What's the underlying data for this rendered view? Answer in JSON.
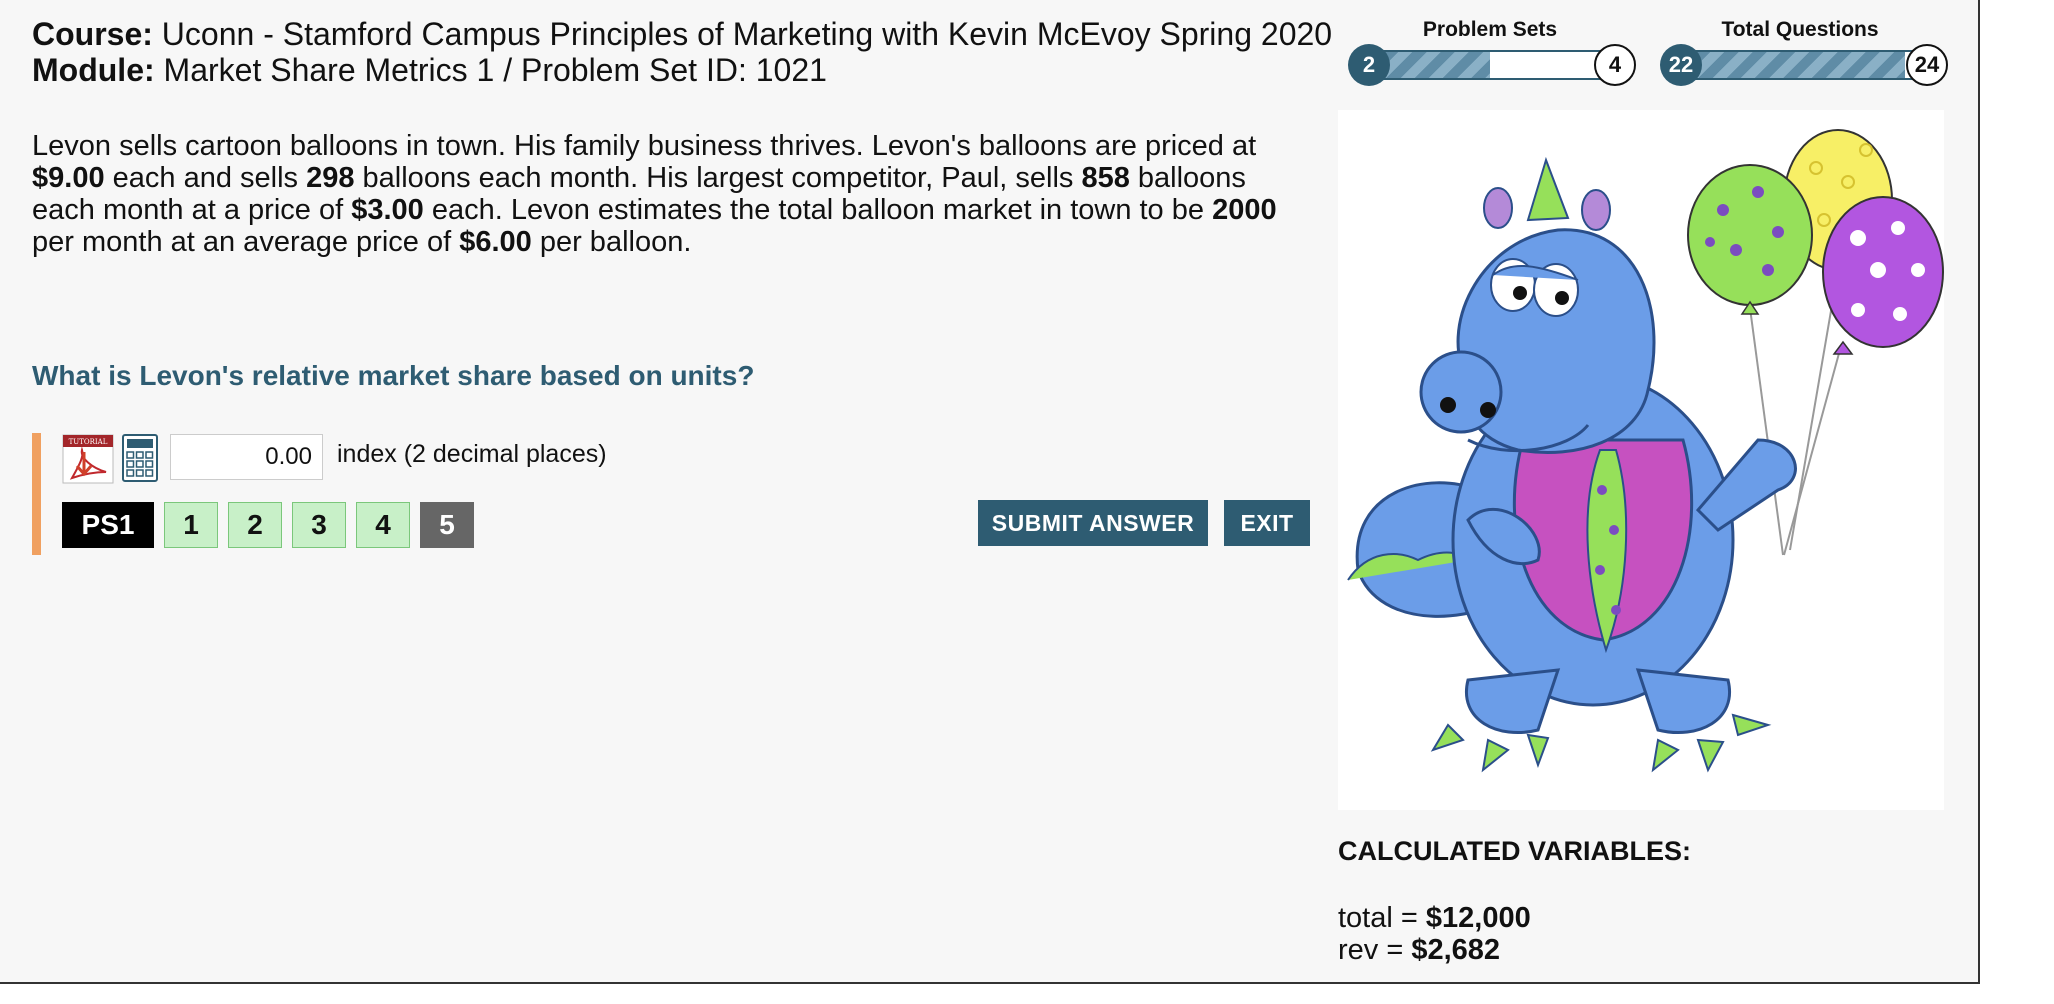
{
  "header": {
    "course_label": "Course:",
    "course_value": "Uconn - Stamford Campus Principles of Marketing with Kevin McEvoy Spring 2020",
    "module_label": "Module:",
    "module_value": "Market Share Metrics 1 / Problem Set ID: 1021"
  },
  "problem": {
    "t1": "Levon sells cartoon balloons in town. His family business thrives. Levon's balloons are priced at ",
    "price": "$9.00",
    "t2": " each and sells ",
    "units": "298",
    "t3": " balloons each month. His largest competitor, Paul, sells ",
    "comp_units": "858",
    "t4": " balloons each month at a price of ",
    "comp_price": "$3.00",
    "t5": " each. Levon estimates the total balloon market in town to be ",
    "market": "2000",
    "t6": " per month at an average price of ",
    "avg_price": "$6.00",
    "t7": " per balloon."
  },
  "question": "What is Levon's relative market share based on units?",
  "answer": {
    "value": "0.00",
    "unit_label": "index (2 decimal places)",
    "tutorial_icon_text": "TUTORIAL"
  },
  "problem_sets": {
    "label": "PS1",
    "items": [
      "1",
      "2",
      "3",
      "4",
      "5"
    ],
    "active_index": 4
  },
  "buttons": {
    "submit": "SUBMIT ANSWER",
    "exit": "EXIT"
  },
  "progress": {
    "problem_sets": {
      "label": "Problem Sets",
      "current": "2",
      "total": "4",
      "fraction": 0.5
    },
    "total_questions": {
      "label": "Total Questions",
      "current": "22",
      "total": "24",
      "fraction": 0.92
    }
  },
  "calculated": {
    "title": "CALCULATED VARIABLES:",
    "rows": [
      {
        "name": "total = ",
        "value": "$12,000"
      },
      {
        "name": "rev = ",
        "value": "$2,682"
      }
    ]
  },
  "colors": {
    "accent": "#2e5c72",
    "answer_bar": "#f0a060",
    "ps_done": "#c8f0c8",
    "ps_active": "#666666"
  }
}
